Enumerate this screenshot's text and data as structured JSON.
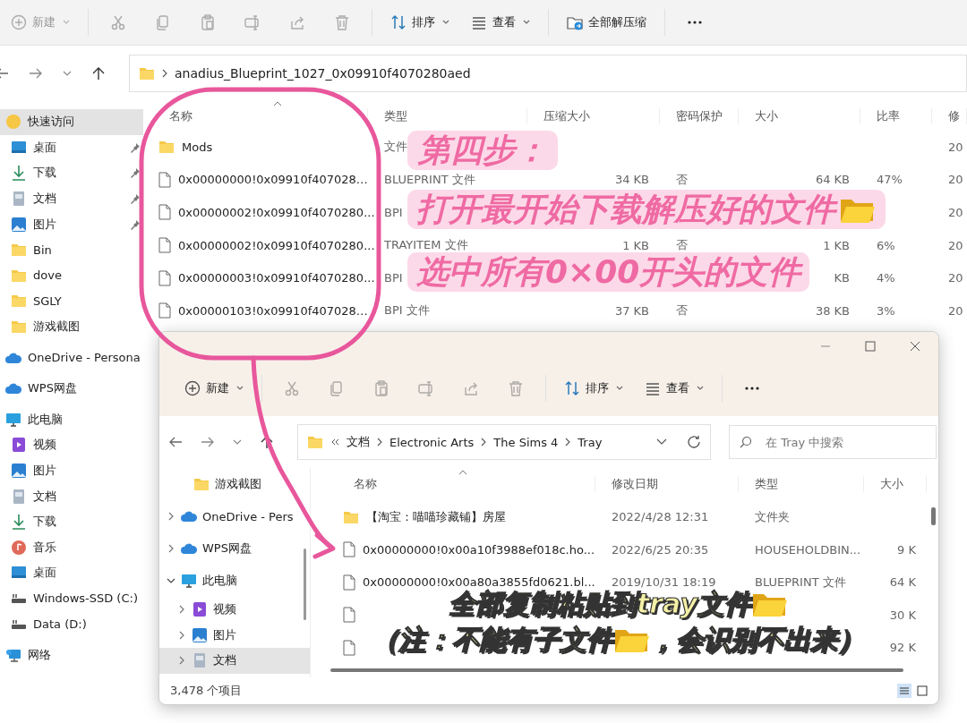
{
  "back_window": {
    "toolbar": [
      {
        "kind": "new",
        "label": "新建",
        "dropdown": true,
        "disabled": true
      },
      {
        "kind": "cut",
        "disabled": true
      },
      {
        "kind": "copy",
        "disabled": true
      },
      {
        "kind": "paste",
        "disabled": true
      },
      {
        "kind": "rename",
        "disabled": true
      },
      {
        "kind": "share",
        "disabled": true
      },
      {
        "kind": "delete",
        "disabled": true
      },
      {
        "kind": "sort",
        "label": "排序",
        "dropdown": true,
        "disabled": false
      },
      {
        "kind": "view",
        "label": "查看",
        "dropdown": true,
        "disabled": false
      },
      {
        "kind": "extract",
        "label": "全部解压缩",
        "dropdown": false,
        "disabled": false
      },
      {
        "kind": "more",
        "disabled": false
      }
    ],
    "address": "anadius_Blueprint_1027_0x09910f4070280aed",
    "sidebar": [
      {
        "kind": "star",
        "label": "快速访问",
        "selected": true,
        "pinned": false
      },
      {
        "kind": "desktop",
        "label": "桌面",
        "selected": false,
        "pinned": true
      },
      {
        "kind": "download",
        "label": "下载",
        "selected": false,
        "pinned": true
      },
      {
        "kind": "docs",
        "label": "文档",
        "selected": false,
        "pinned": true
      },
      {
        "kind": "pictures",
        "label": "图片",
        "selected": false,
        "pinned": true
      },
      {
        "kind": "folder",
        "label": "Bin",
        "selected": false,
        "pinned": false
      },
      {
        "kind": "folder",
        "label": "dove",
        "selected": false,
        "pinned": false
      },
      {
        "kind": "folder",
        "label": "SGLY",
        "selected": false,
        "pinned": false
      },
      {
        "kind": "folder",
        "label": "游戏截图",
        "selected": false,
        "pinned": false
      },
      {
        "kind": "cloud",
        "label": "OneDrive - Persona",
        "selected": false,
        "pinned": false
      },
      {
        "kind": "cloud",
        "label": "WPS网盘",
        "selected": false,
        "pinned": false
      },
      {
        "kind": "pc",
        "label": "此电脑",
        "selected": false,
        "pinned": false
      },
      {
        "kind": "video",
        "label": "视频",
        "selected": false,
        "pinned": false
      },
      {
        "kind": "pictures",
        "label": "图片",
        "selected": false,
        "pinned": false
      },
      {
        "kind": "docs",
        "label": "文档",
        "selected": false,
        "pinned": false
      },
      {
        "kind": "download",
        "label": "下载",
        "selected": false,
        "pinned": false
      },
      {
        "kind": "music",
        "label": "音乐",
        "selected": false,
        "pinned": false
      },
      {
        "kind": "desktop",
        "label": "桌面",
        "selected": false,
        "pinned": false
      },
      {
        "kind": "drive",
        "label": "Windows-SSD (C:)",
        "selected": false,
        "pinned": false
      },
      {
        "kind": "drive",
        "label": "Data (D:)",
        "selected": false,
        "pinned": false
      },
      {
        "kind": "network",
        "label": "网络",
        "selected": false,
        "pinned": false
      }
    ],
    "columns": [
      "名称",
      "类型",
      "压缩大小",
      "密码保护",
      "大小",
      "比率",
      "修"
    ],
    "rows": [
      {
        "kind": "folder",
        "name": "Mods",
        "type": "文件",
        "modified": "20"
      },
      {
        "kind": "file",
        "name": "0x00000000!0x09910f407028…",
        "type": "BLUEPRINT 文件",
        "packed": "34 KB",
        "password": "否",
        "size": "64 KB",
        "ratio": "47%",
        "modified": "20"
      },
      {
        "kind": "file",
        "name": "0x00000002!0x09910f4070280...",
        "type": "BPI",
        "modified": "20"
      },
      {
        "kind": "file",
        "name": "0x00000002!0x09910f4070280...",
        "type": "TRAYITEM 文件",
        "packed": "1 KB",
        "password": "否",
        "size": "1 KB",
        "ratio": "6%",
        "modified": "20"
      },
      {
        "kind": "file",
        "name": "0x00000003!0x09910f4070280...",
        "type": "BPI",
        "size": "KB",
        "ratio": "4%",
        "modified": "20"
      },
      {
        "kind": "file",
        "name": "0x00000103!0x09910f407028…",
        "type": "BPI 文件",
        "packed": "37 KB",
        "password": "否",
        "size": "38 KB",
        "ratio": "3%",
        "modified": "20"
      }
    ]
  },
  "front_window": {
    "toolbar": [
      {
        "kind": "new",
        "label": "新建",
        "dropdown": true,
        "disabled": false
      },
      {
        "kind": "cut",
        "disabled": true
      },
      {
        "kind": "copy",
        "disabled": true
      },
      {
        "kind": "paste",
        "disabled": true
      },
      {
        "kind": "rename",
        "disabled": true
      },
      {
        "kind": "share",
        "disabled": true
      },
      {
        "kind": "delete",
        "disabled": true
      },
      {
        "kind": "sort",
        "label": "排序",
        "dropdown": true,
        "disabled": false
      },
      {
        "kind": "view",
        "label": "查看",
        "dropdown": true,
        "disabled": false
      },
      {
        "kind": "more",
        "disabled": false
      }
    ],
    "breadcrumb": [
      "文档",
      "Electronic Arts",
      "The Sims 4",
      "Tray"
    ],
    "search": {
      "placeholder": "在 Tray 中搜索"
    },
    "sidebar": [
      {
        "kind": "folder",
        "label": "游戏截图",
        "selected": false
      },
      {
        "kind": "cloud",
        "label": "OneDrive - Pers",
        "selected": false,
        "expanded": false
      },
      {
        "kind": "cloud",
        "label": "WPS网盘",
        "selected": false,
        "expanded": false
      },
      {
        "kind": "pc",
        "label": "此电脑",
        "selected": false,
        "expanded": true,
        "children": [
          {
            "kind": "video",
            "label": "视频",
            "selected": false,
            "expanded": false
          },
          {
            "kind": "pictures",
            "label": "图片",
            "selected": false,
            "expanded": false
          },
          {
            "kind": "docs",
            "label": "文档",
            "selected": true,
            "expanded": false
          }
        ]
      }
    ],
    "columns": [
      "名称",
      "修改日期",
      "类型",
      "大小"
    ],
    "rows": [
      {
        "kind": "folder",
        "name": "【淘宝：喵喵珍藏铺】房屋",
        "modified": "2022/4/28 12:31",
        "type": "文件夹"
      },
      {
        "kind": "file",
        "name": "0x00000000!0x00a10f3988ef018c.ho...",
        "modified": "2022/6/25 20:35",
        "type": "HOUSEHOLDBIN...",
        "size": "9 K"
      },
      {
        "kind": "file",
        "name": "0x00000000!0x00a80a3855fd0621.bl...",
        "modified": "2019/10/31 18:19",
        "type": "BLUEPRINT 文件",
        "size": "64 K"
      },
      {
        "kind": "file",
        "size": "30 K"
      },
      {
        "kind": "file",
        "size": "92 K"
      }
    ],
    "status": "3,478 个项目",
    "view_buttons": [
      {
        "kind": "details",
        "selected": true
      },
      {
        "kind": "tiles",
        "selected": false
      }
    ]
  },
  "annotations": {
    "step": "第四步：",
    "lines": [
      "打开最开始下载解压好的文件",
      "选中所有0×00开头的文件"
    ],
    "captions": [
      [
        "全部复制粘贴到tray文件"
      ],
      [
        "（注：不能有子文件",
        "，会识别不出来）"
      ]
    ]
  }
}
